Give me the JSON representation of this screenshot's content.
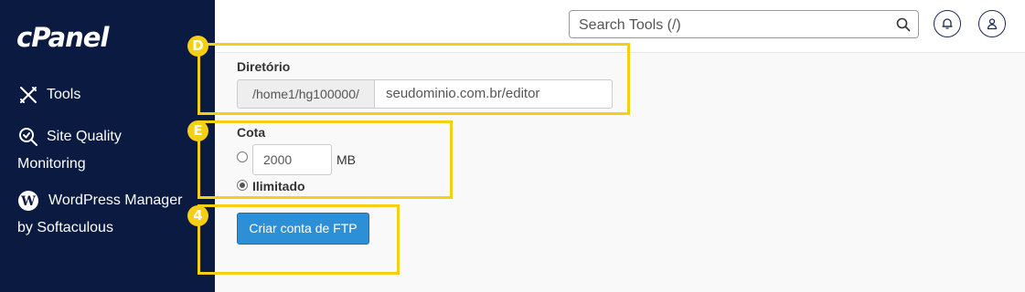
{
  "sidebar": {
    "logo": "cPanel",
    "items": [
      {
        "label": "Tools",
        "icon": "tools-icon"
      },
      {
        "label_line1": "Site Quality",
        "label_line2": "Monitoring",
        "icon": "site-quality-icon"
      },
      {
        "label_line1": "WordPress Manager",
        "label_line2": "by Softaculous",
        "icon": "wordpress-icon"
      }
    ]
  },
  "header": {
    "search_placeholder": "Search Tools (/)"
  },
  "form": {
    "directory_label": "Diretório",
    "directory_prefix": "/home1/hg100000/",
    "directory_value": "seudominio.com.br/editor",
    "quota_label": "Cota",
    "quota_value": "2000",
    "quota_unit": "MB",
    "unlimited_label": "Ilimitado",
    "unlimited_selected": true,
    "submit_label": "Criar conta de FTP"
  },
  "annotations": [
    {
      "marker": "D"
    },
    {
      "marker": "E"
    },
    {
      "marker": "4"
    }
  ],
  "colors": {
    "sidebar_bg": "#0b1a40",
    "primary_button": "#2d8fd5",
    "annotation": "#f5cf14"
  }
}
